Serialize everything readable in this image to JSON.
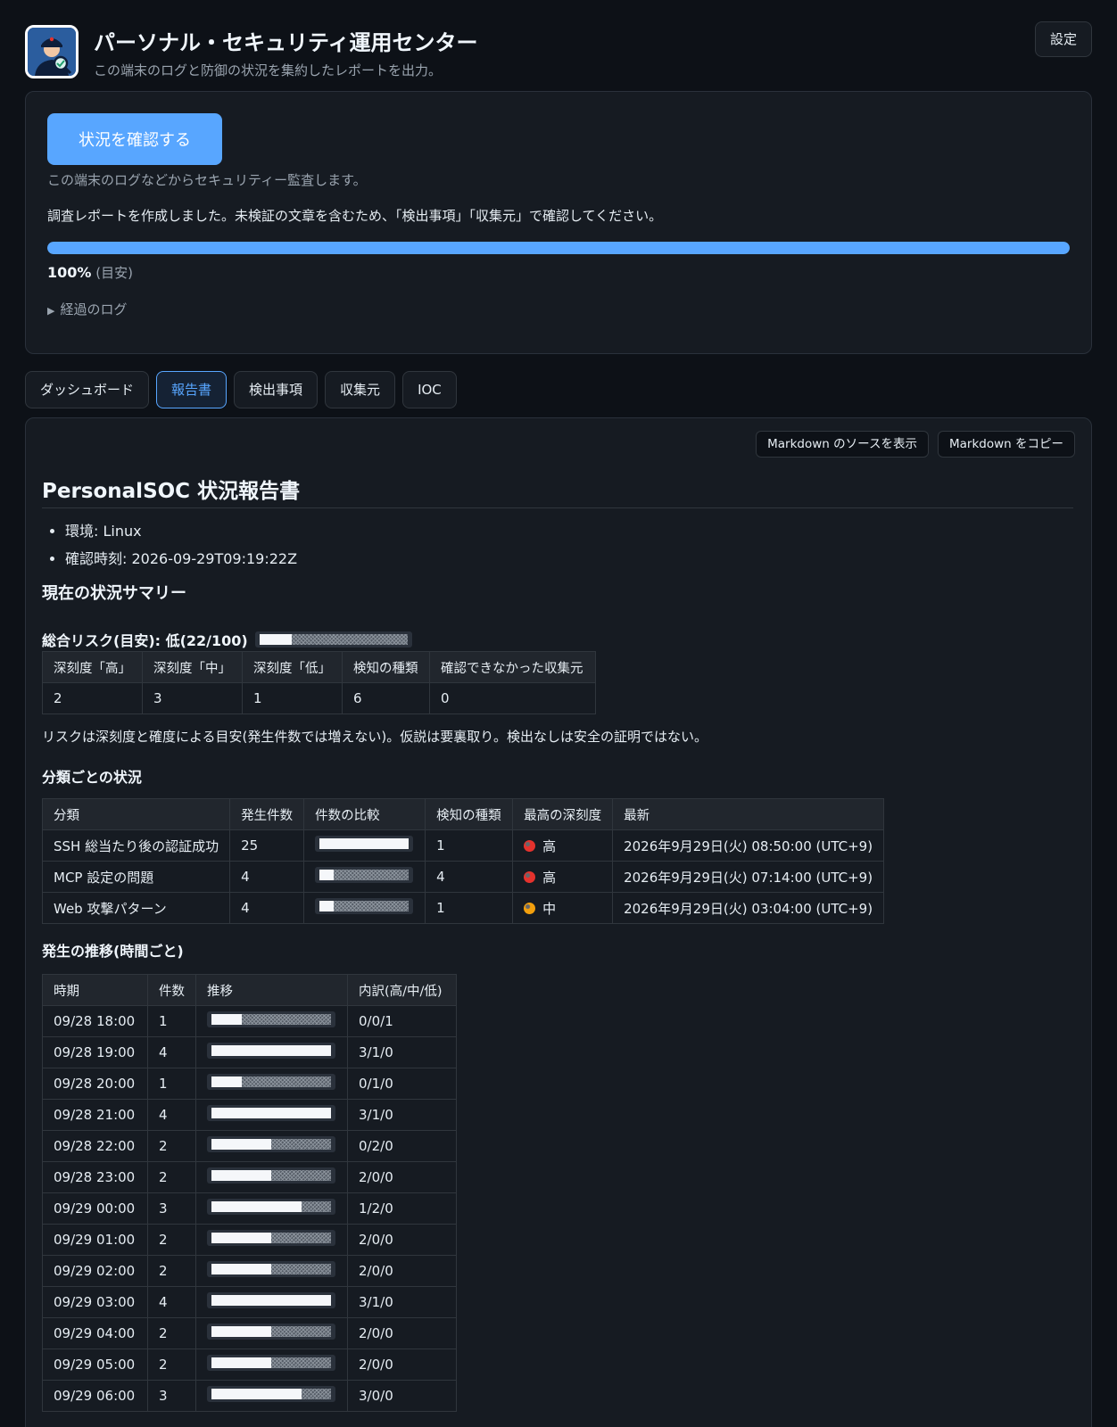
{
  "header": {
    "title": "パーソナル・セキュリティ運用センター",
    "subtitle": "この端末のログと防御の状況を集約したレポートを出力。",
    "settings_label": "設定",
    "icon": "security-officer-icon"
  },
  "status": {
    "check_button": "状況を確認する",
    "sub": "この端末のログなどからセキュリティー監査します。",
    "message": "調査レポートを作成しました。未検証の文章を含むため、「検出事項」「収集元」で確認してください。",
    "progress": 100,
    "progress_text": "100%",
    "progress_note": "(目安)",
    "log_toggle": "経過のログ"
  },
  "tabs": [
    {
      "label": "ダッシュボード",
      "active": false
    },
    {
      "label": "報告書",
      "active": true
    },
    {
      "label": "検出事項",
      "active": false
    },
    {
      "label": "収集元",
      "active": false
    },
    {
      "label": "IOC",
      "active": false
    }
  ],
  "report": {
    "md_source_label": "Markdown のソースを表示",
    "md_copy_label": "Markdown をコピー",
    "title": "PersonalSOC 状況報告書",
    "meta": [
      "環境: Linux",
      "確認時刻: 2026-09-29T09:19:22Z"
    ],
    "summary_heading": "現在の状況サマリー",
    "risk_label": "総合リスク(目安): 低(22/100)",
    "risk_fraction": 0.22,
    "summary_table": {
      "headers": [
        "深刻度「高」",
        "深刻度「中」",
        "深刻度「低」",
        "検知の種類",
        "確認できなかった収集元"
      ],
      "values": [
        "2",
        "3",
        "1",
        "6",
        "0"
      ]
    },
    "note": "リスクは深刻度と確度による目安(発生件数では増えない)。仮説は要裏取り。検出なしは安全の証明ではない。",
    "category_heading": "分類ごとの状況",
    "category_table": {
      "headers": [
        "分類",
        "発生件数",
        "件数の比較",
        "検知の種類",
        "最高の深刻度",
        "最新"
      ],
      "rows": [
        {
          "name": "SSH 総当たり後の認証成功",
          "count": "25",
          "fraction": 1.0,
          "kinds": "1",
          "severity": "高",
          "severity_color": "#e5322d",
          "latest": "2026年9月29日(火) 08:50:00 (UTC+9)"
        },
        {
          "name": "MCP 設定の問題",
          "count": "4",
          "fraction": 0.16,
          "kinds": "4",
          "severity": "高",
          "severity_color": "#e5322d",
          "latest": "2026年9月29日(火) 07:14:00 (UTC+9)"
        },
        {
          "name": "Web 攻撃パターン",
          "count": "4",
          "fraction": 0.16,
          "kinds": "1",
          "severity": "中",
          "severity_color": "#f29f0d",
          "latest": "2026年9月29日(火) 03:04:00 (UTC+9)"
        }
      ]
    },
    "trend_heading": "発生の推移(時間ごと)",
    "trend_table": {
      "headers": [
        "時期",
        "件数",
        "推移",
        "内訳(高/中/低)"
      ],
      "rows": [
        {
          "time": "09/28 18:00",
          "count": "1",
          "fraction": 0.25,
          "breakdown": "0/0/1"
        },
        {
          "time": "09/28 19:00",
          "count": "4",
          "fraction": 1.0,
          "breakdown": "3/1/0"
        },
        {
          "time": "09/28 20:00",
          "count": "1",
          "fraction": 0.25,
          "breakdown": "0/1/0"
        },
        {
          "time": "09/28 21:00",
          "count": "4",
          "fraction": 1.0,
          "breakdown": "3/1/0"
        },
        {
          "time": "09/28 22:00",
          "count": "2",
          "fraction": 0.5,
          "breakdown": "0/2/0"
        },
        {
          "time": "09/28 23:00",
          "count": "2",
          "fraction": 0.5,
          "breakdown": "2/0/0"
        },
        {
          "time": "09/29 00:00",
          "count": "3",
          "fraction": 0.75,
          "breakdown": "1/2/0"
        },
        {
          "time": "09/29 01:00",
          "count": "2",
          "fraction": 0.5,
          "breakdown": "2/0/0"
        },
        {
          "time": "09/29 02:00",
          "count": "2",
          "fraction": 0.5,
          "breakdown": "2/0/0"
        },
        {
          "time": "09/29 03:00",
          "count": "4",
          "fraction": 1.0,
          "breakdown": "3/1/0"
        },
        {
          "time": "09/29 04:00",
          "count": "2",
          "fraction": 0.5,
          "breakdown": "2/0/0"
        },
        {
          "time": "09/29 05:00",
          "count": "2",
          "fraction": 0.5,
          "breakdown": "2/0/0"
        },
        {
          "time": "09/29 06:00",
          "count": "3",
          "fraction": 0.75,
          "breakdown": "3/0/0"
        }
      ]
    }
  }
}
